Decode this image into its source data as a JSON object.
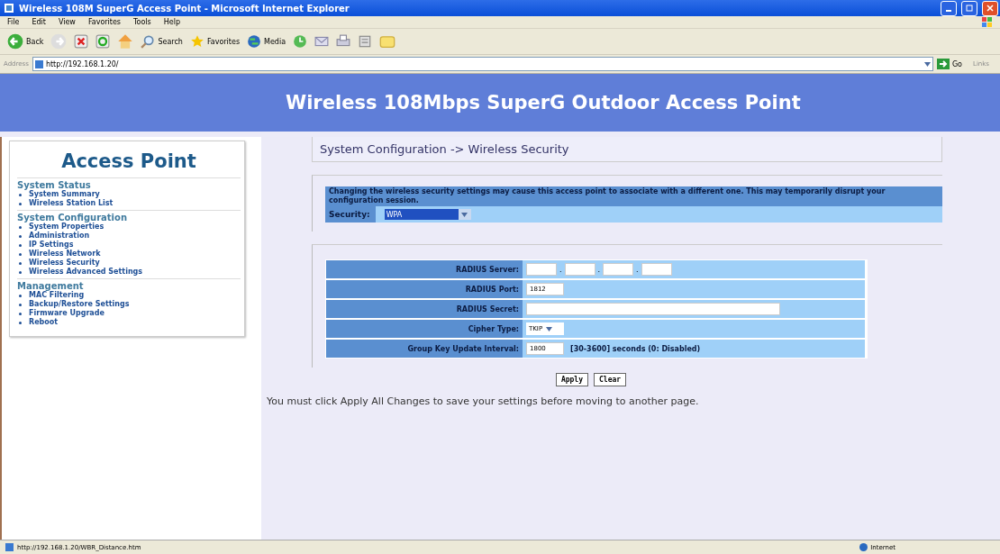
{
  "window": {
    "title": "Wireless 108M SuperG Access Point - Microsoft Internet Explorer"
  },
  "menu": [
    "File",
    "Edit",
    "View",
    "Favorites",
    "Tools",
    "Help"
  ],
  "toolbar": [
    {
      "kind": "back",
      "label": "Back"
    },
    {
      "kind": "forward"
    },
    {
      "kind": "stop"
    },
    {
      "kind": "refresh"
    },
    {
      "kind": "home"
    },
    {
      "kind": "search",
      "label": "Search"
    },
    {
      "kind": "favorites",
      "label": "Favorites"
    },
    {
      "kind": "media",
      "label": "Media"
    },
    {
      "kind": "history"
    },
    {
      "kind": "mail"
    },
    {
      "kind": "print"
    },
    {
      "kind": "edit"
    },
    {
      "kind": "folder"
    }
  ],
  "address": {
    "label": "Address",
    "value": "http://192.168.1.20/",
    "go": "Go",
    "links": "Links"
  },
  "banner": {
    "title": "Wireless 108Mbps SuperG Outdoor Access Point"
  },
  "sidebar": {
    "title": "Access Point",
    "sections": [
      {
        "heading": "System Status",
        "items": [
          "System Summary",
          "Wireless Station List"
        ]
      },
      {
        "heading": "System Configuration",
        "items": [
          "System Properties",
          "Administration",
          "IP Settings",
          "Wireless Network",
          "Wireless Security",
          "Wireless Advanced Settings"
        ]
      },
      {
        "heading": "Management",
        "items": [
          "MAC Filtering",
          "Backup/Restore Settings",
          "Firmware Upgrade",
          "Reboot"
        ]
      }
    ]
  },
  "breadcrumb": "System Configuration -> Wireless Security",
  "security": {
    "notice": "Changing the wireless security settings may cause this access point to associate with a different one. This may temporarily disrupt your configuration session.",
    "label": "Security:",
    "value": "WPA"
  },
  "form": {
    "rows": [
      {
        "kind": "ip",
        "label": "RADIUS Server:",
        "separator": "."
      },
      {
        "kind": "short",
        "label": "RADIUS Port:",
        "value": "1812"
      },
      {
        "kind": "long",
        "label": "RADIUS Secret:"
      },
      {
        "kind": "select",
        "label": "Cipher Type:",
        "value": "TKIP"
      },
      {
        "kind": "short",
        "label": "Group Key Update Interval:",
        "value": "1800",
        "note": "[30-3600] seconds (0: Disabled)"
      }
    ],
    "buttons": [
      "Apply",
      "Clear"
    ]
  },
  "footer_note": "You must click Apply All Changes to save your settings before moving to another page.",
  "status_bar": {
    "url": "http://192.168.1.20/WBR_Distance.htm",
    "zone": "Internet"
  }
}
